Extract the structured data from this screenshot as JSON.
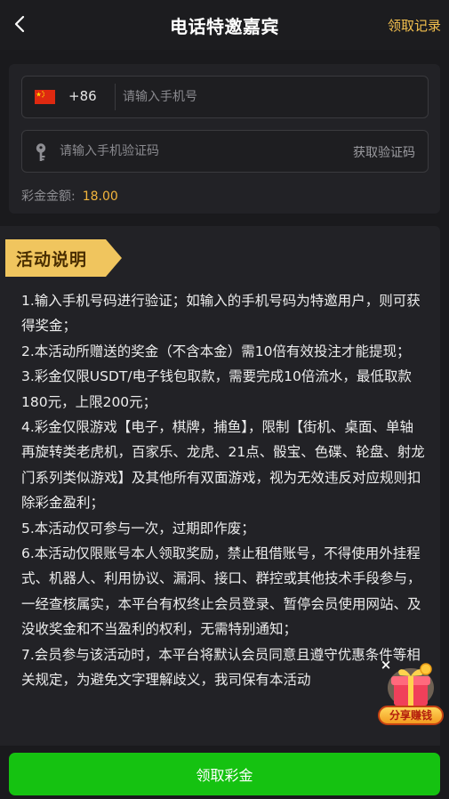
{
  "header": {
    "title": "电话特邀嘉宾",
    "record_link": "领取记录"
  },
  "form": {
    "dial_code": "+86",
    "phone_placeholder": "请输入手机号",
    "code_placeholder": "请输入手机验证码",
    "get_code_label": "获取验证码",
    "bonus_label": "彩金金额:",
    "bonus_value": "18.00"
  },
  "activity": {
    "title": "活动说明",
    "rules": [
      "1.输入手机号码进行验证；如输入的手机号码为特邀用户，则可获得奖金；",
      "2.本活动所赠送的奖金（不含本金）需10倍有效投注才能提现；",
      "3.彩金仅限USDT/电子钱包取款，需要完成10倍流水，最低取款180元，上限200元；",
      "4.彩金仅限游戏【电子，棋牌，捕鱼】，限制【街机、桌面、单轴再旋转类老虎机，百家乐、龙虎、21点、骰宝、色碟、轮盘、射龙门系列类似游戏】及其他所有双面游戏，视为无效违反对应规则扣除彩金盈利；",
      "5.本活动仅可参与一次，过期即作废；",
      "6.本活动仅限账号本人领取奖励，禁止租借账号，不得使用外挂程式、机器人、利用协议、漏洞、接口、群控或其他技术手段参与，一经查核属实，本平台有权终止会员登录、暂停会员使用网站、及没收奖金和不当盈利的权利，无需特别通知；",
      "7.会员参与该活动时，本平台将默认会员同意且遵守优惠条件等相关规定，为避免文字理解歧义，我司保有本活动"
    ]
  },
  "share_widget": {
    "label": "分享赚钱"
  },
  "footer": {
    "claim_label": "领取彩金"
  },
  "colors": {
    "accent_gold": "#f3c04e",
    "bonus_orange": "#f3b53c",
    "primary_green": "#15c211",
    "background": "#1a1a1d",
    "card": "#222226"
  },
  "icons": {
    "back": "chevron-left-icon",
    "flag": "china-flag-icon",
    "key": "key-icon",
    "close": "close-icon",
    "gift": "gift-icon"
  }
}
